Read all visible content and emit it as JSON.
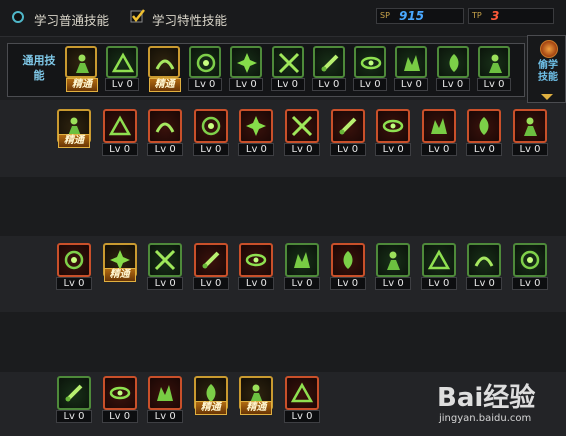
{
  "tabs": [
    {
      "label": "学习普通技能",
      "selected": false
    },
    {
      "label": "学习特性技能",
      "selected": true
    }
  ],
  "stats": [
    {
      "icon": "sp-icon",
      "value": "915",
      "color": "#4aa8ff"
    },
    {
      "icon": "tp-icon",
      "value": "3",
      "color": "#ff5a3a"
    }
  ],
  "general_panel": {
    "label": "通用技能",
    "skills": [
      {
        "icon": "sit-figure-icon",
        "level": "精通",
        "mastered": true
      },
      {
        "icon": "crouch-figure-icon",
        "level": "Lv 0",
        "mastered": false
      },
      {
        "icon": "dragon-icon",
        "level": "精通",
        "mastered": true
      },
      {
        "icon": "wings-icon",
        "level": "Lv 0",
        "mastered": false
      },
      {
        "icon": "target-icon",
        "level": "Lv 0",
        "mastered": false
      },
      {
        "icon": "radar-icon",
        "level": "Lv 0",
        "mastered": false
      },
      {
        "icon": "bust-icon",
        "level": "Lv 0",
        "mastered": false
      },
      {
        "icon": "spark-bust-icon",
        "level": "Lv 0",
        "mastered": false
      },
      {
        "icon": "eye-icon",
        "level": "Lv 0",
        "mastered": false
      },
      {
        "icon": "muscle-icon",
        "level": "Lv 0",
        "mastered": false
      },
      {
        "icon": "swirl-figure-icon",
        "level": "Lv 0",
        "mastered": false
      }
    ]
  },
  "side_panel": {
    "label": "偷学技能",
    "arrow": "expand-arrow-icon"
  },
  "skill_rows": [
    [
      {
        "icon": "dash-figure-icon",
        "level": "精通",
        "mastered": true,
        "frame": "gold"
      },
      {
        "icon": "slash-wave-icon",
        "level": "Lv 0",
        "mastered": false,
        "frame": "red"
      },
      {
        "icon": "blade-arc-icon",
        "level": "Lv 0",
        "mastered": false,
        "frame": "red"
      },
      {
        "icon": "mask-icon",
        "level": "Lv 0",
        "mastered": false,
        "frame": "red"
      },
      {
        "icon": "gear-icon",
        "level": "Lv 0",
        "mastered": false,
        "frame": "red"
      },
      {
        "icon": "burst-icon",
        "level": "Lv 0",
        "mastered": false,
        "frame": "red"
      },
      {
        "icon": "strike-figure-icon",
        "level": "Lv 0",
        "mastered": false,
        "frame": "red"
      },
      {
        "icon": "flame-fist-icon",
        "level": "Lv 0",
        "mastered": false,
        "frame": "red"
      },
      {
        "icon": "cross-swords-icon",
        "level": "Lv 0",
        "mastered": false,
        "frame": "red"
      },
      {
        "icon": "sword-icon",
        "level": "Lv 0",
        "mastered": false,
        "frame": "red"
      },
      {
        "icon": "spin-icon",
        "level": "Lv 0",
        "mastered": false,
        "frame": "red"
      }
    ],
    [
      {
        "icon": "skull-gear-icon",
        "level": "Lv 0",
        "mastered": false,
        "frame": "red"
      },
      {
        "icon": "green-blast-icon",
        "level": "精通",
        "mastered": true,
        "frame": "gold"
      },
      {
        "icon": "cleaver-icon",
        "level": "Lv 0",
        "mastered": false,
        "frame": "green"
      },
      {
        "icon": "demon-face-icon",
        "level": "Lv 0",
        "mastered": false,
        "frame": "red"
      },
      {
        "icon": "moon-icon",
        "level": "Lv 0",
        "mastered": false,
        "frame": "red"
      },
      {
        "icon": "jaws-icon",
        "level": "Lv 0",
        "mastered": false,
        "frame": "green"
      },
      {
        "icon": "spiral-icon",
        "level": "Lv 0",
        "mastered": false,
        "frame": "red"
      },
      {
        "icon": "stripe-blade-icon",
        "level": "Lv 0",
        "mastered": false,
        "frame": "green"
      },
      {
        "icon": "leaf-icon",
        "level": "Lv 0",
        "mastered": false,
        "frame": "green"
      },
      {
        "icon": "crossed-beams-icon",
        "level": "Lv 0",
        "mastered": false,
        "frame": "green"
      },
      {
        "icon": "wind-icon",
        "level": "Lv 0",
        "mastered": false,
        "frame": "green"
      }
    ],
    [
      {
        "icon": "claw-icon",
        "level": "Lv 0",
        "mastered": false,
        "frame": "green"
      },
      {
        "icon": "twin-blades-icon",
        "level": "Lv 0",
        "mastered": false,
        "frame": "red"
      },
      {
        "icon": "sunburst-icon",
        "level": "Lv 0",
        "mastered": false,
        "frame": "red"
      },
      {
        "icon": "scroll-icon",
        "level": "精通",
        "mastered": true,
        "frame": "gold"
      },
      {
        "icon": "guardian-icon",
        "level": "精通",
        "mastered": true,
        "frame": "gold"
      },
      {
        "icon": "feather-icon",
        "level": "Lv 0",
        "mastered": false,
        "frame": "red"
      }
    ]
  ],
  "watermark": {
    "logo": "Bai经验",
    "sub": "jingyan.baidu.com"
  }
}
